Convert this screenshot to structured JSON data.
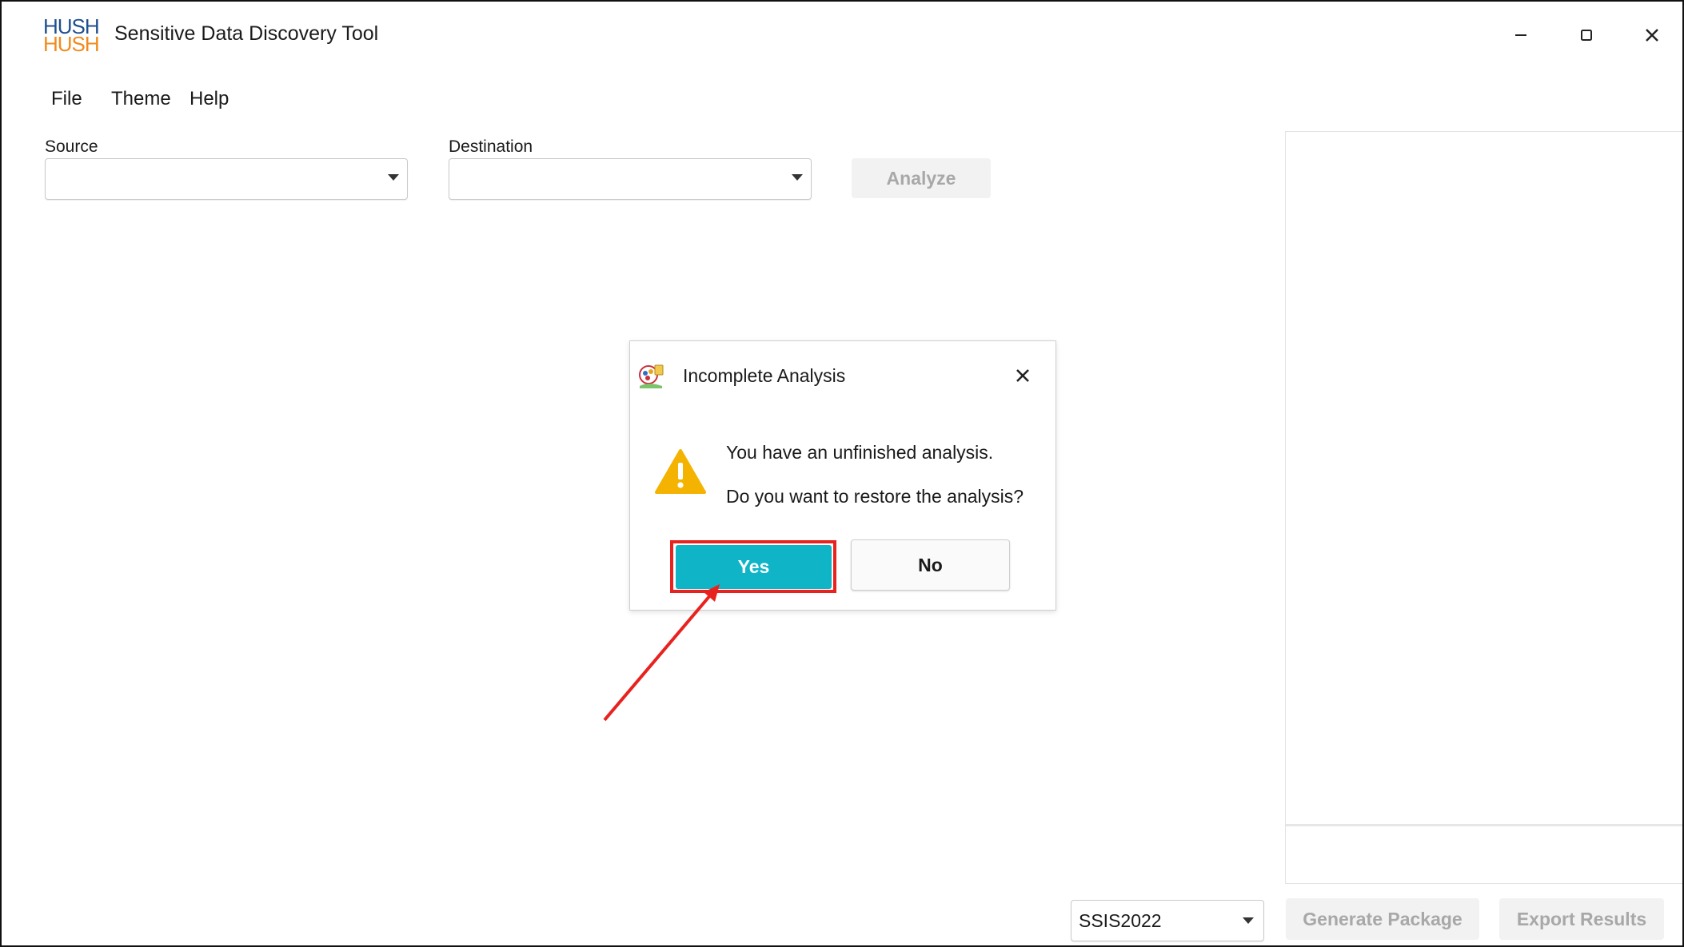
{
  "app": {
    "logo_line1": "HUSH",
    "logo_line2": "HUSH",
    "title": "Sensitive Data Discovery Tool"
  },
  "window_controls": [
    "minimize-icon",
    "maximize-icon",
    "close-icon"
  ],
  "menu": {
    "file": "File",
    "theme": "Theme",
    "help": "Help"
  },
  "form": {
    "source_label": "Source",
    "source_value": "",
    "destination_label": "Destination",
    "destination_value": "",
    "analyze_label": "Analyze"
  },
  "bottom_bar": {
    "version_value": "SSIS2022",
    "generate_label": "Generate Package",
    "export_label": "Export Results"
  },
  "dialog": {
    "title": "Incomplete Analysis",
    "message_line1": "You have an unfinished analysis.",
    "message_line2": "Do you want to restore the analysis?",
    "yes_label": "Yes",
    "no_label": "No"
  },
  "colors": {
    "yes_button": "#0fb5c6",
    "highlight": "#e8231f",
    "warning": "#f5b301",
    "logo_blue": "#1f4f8f",
    "logo_orange": "#f08a1c",
    "disabled_button_bg": "#f2f2f2",
    "disabled_button_text": "#a8a8a8"
  }
}
